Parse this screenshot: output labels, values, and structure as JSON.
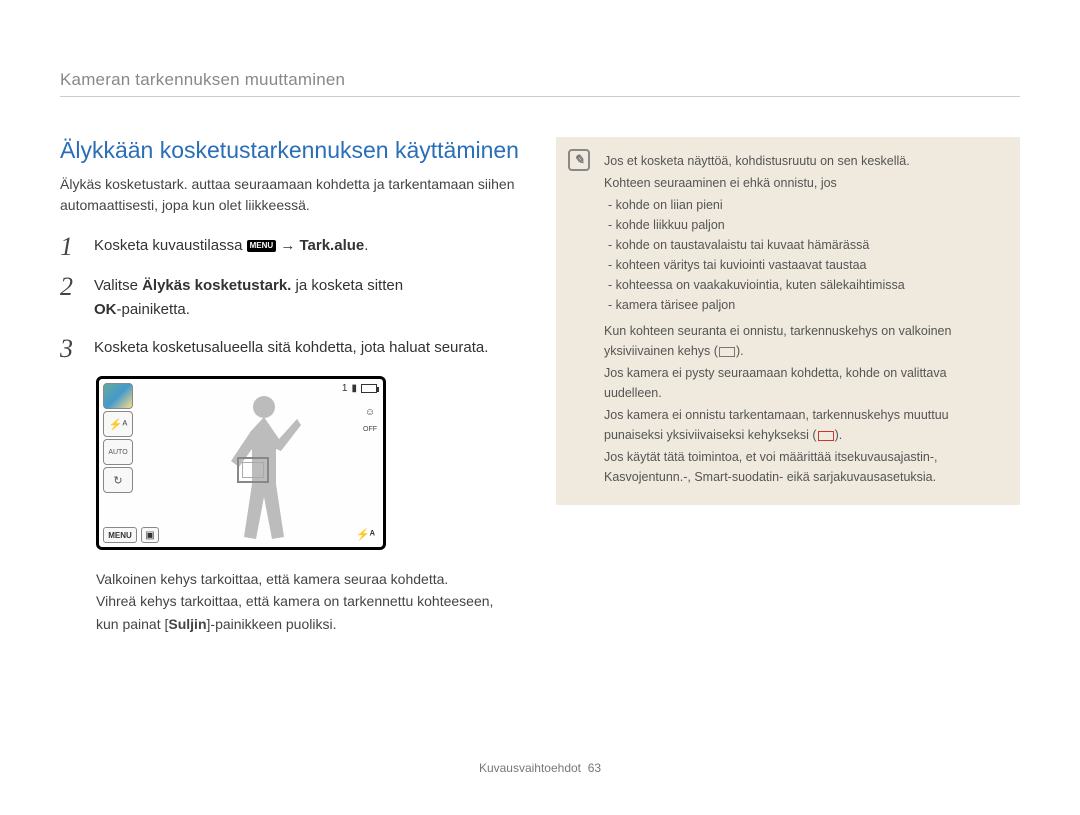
{
  "header": {
    "breadcrumb": "Kameran tarkennuksen muuttaminen"
  },
  "section": {
    "title": "Älykkään kosketustarkennuksen käyttäminen",
    "intro": "Älykäs kosketustark. auttaa seuraamaan kohdetta ja tarkentamaan siihen automaattisesti, jopa kun olet liikkeessä."
  },
  "steps": {
    "s1": {
      "num": "1",
      "pre": "Kosketa kuvaustilassa ",
      "menu": "MENU",
      "arrow": " → ",
      "bold": "Tark.alue",
      "post": "."
    },
    "s2": {
      "num": "2",
      "pre": "Valitse ",
      "bold": "Älykäs kosketustark.",
      "mid": " ja kosketa sitten ",
      "ok": "OK",
      "post": "-painiketta."
    },
    "s3": {
      "num": "3",
      "text": "Kosketa kosketusalueella sitä kohdetta, jota haluat seurata."
    }
  },
  "camera": {
    "top_right_num": "1",
    "menu_label": "MENU",
    "flash_a_bottom": "⚡ᴬ",
    "left_icons": {
      "flash": "⚡ᴬ",
      "auto": "AUTO",
      "timer": "↻"
    },
    "right_icons": {
      "face": "☺",
      "off": "OFF"
    }
  },
  "notes": {
    "line1": "Valkoinen kehys tarkoittaa, että kamera seuraa kohdetta.",
    "line2_a": "Vihreä kehys tarkoittaa, että kamera on tarkennettu kohteeseen, kun painat [",
    "line2_bold": "Suljin",
    "line2_b": "]-painikkeen puoliksi."
  },
  "infobox": {
    "l1": "Jos et kosketa näyttöä, kohdistusruutu on sen keskellä.",
    "l2": "Kohteen seuraaminen ei ehkä onnistu, jos",
    "bullets": {
      "b1": "kohde on liian pieni",
      "b2": "kohde liikkuu paljon",
      "b3": "kohde on taustavalaistu tai kuvaat hämärässä",
      "b4": "kohteen väritys tai kuviointi vastaavat taustaa",
      "b5": "kohteessa on vaakakuviointia, kuten sälekaihtimissa",
      "b6": "kamera tärisee paljon"
    },
    "l3_a": "Kun kohteen seuranta ei onnistu, tarkennuskehys on valkoinen yksiviivainen kehys (",
    "l3_b": ").",
    "l4": "Jos kamera ei pysty seuraamaan kohdetta, kohde on valittava uudelleen.",
    "l5_a": "Jos kamera ei onnistu tarkentamaan, tarkennuskehys muuttuu punaiseksi yksiviivaiseksi kehykseksi (",
    "l5_b": ").",
    "l6": "Jos käytät tätä toimintoa, et voi määrittää itsekuvausajastin-, Kasvojentunn.-, Smart-suodatin- eikä sarjakuvausasetuksia."
  },
  "footer": {
    "label": "Kuvausvaihtoehdot",
    "page": "63"
  }
}
